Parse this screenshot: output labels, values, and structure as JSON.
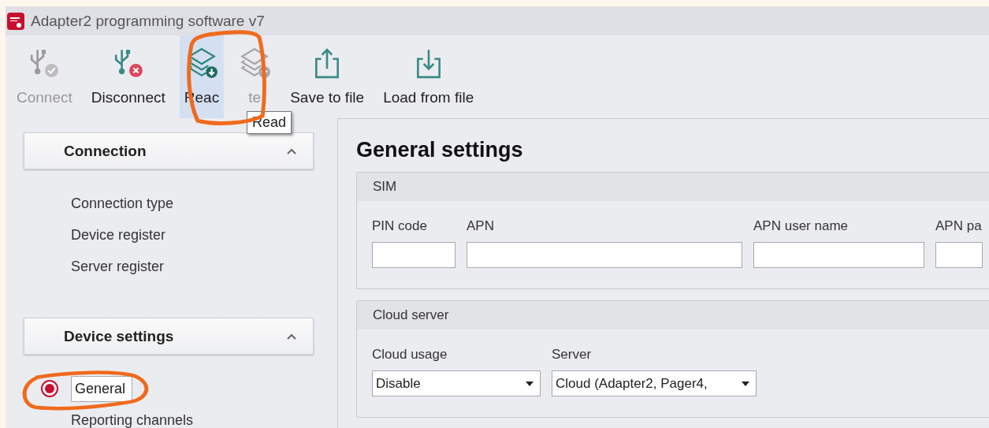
{
  "window": {
    "title": "Adapter2 programming software v7"
  },
  "toolbar": [
    {
      "label": "Connect",
      "kind": "usb-check",
      "disabled": true,
      "hovered": false
    },
    {
      "label": "Disconnect",
      "kind": "usb-x",
      "disabled": false,
      "hovered": false
    },
    {
      "label": "Reac",
      "kind": "layers-down",
      "disabled": false,
      "hovered": true
    },
    {
      "label": "te",
      "kind": "layers-up",
      "disabled": true,
      "hovered": false
    },
    {
      "label": "Save to file",
      "kind": "export",
      "disabled": false,
      "hovered": false
    },
    {
      "label": "Load from file",
      "kind": "import",
      "disabled": false,
      "hovered": false
    }
  ],
  "tooltip": "Read",
  "sidebar": [
    {
      "title": "Connection",
      "expanded": true,
      "items": [
        {
          "label": "Connection type",
          "selected": false
        },
        {
          "label": "Device register",
          "selected": false
        },
        {
          "label": "Server register",
          "selected": false
        }
      ]
    },
    {
      "title": "Device settings",
      "expanded": true,
      "items": [
        {
          "label": "General",
          "selected": true
        },
        {
          "label": "Reporting channels",
          "selected": false
        }
      ]
    }
  ],
  "page": {
    "title": "General settings",
    "groups": [
      {
        "title": "SIM",
        "fields": [
          {
            "label": "PIN code",
            "kind": "text"
          },
          {
            "label": "APN",
            "kind": "text"
          },
          {
            "label": "APN user name",
            "kind": "text"
          },
          {
            "label": "APN pa",
            "kind": "text"
          }
        ]
      },
      {
        "title": "Cloud server",
        "fields": [
          {
            "label": "Cloud usage",
            "kind": "select",
            "value": "Disable"
          },
          {
            "label": "Server",
            "kind": "select",
            "value": "Cloud (Adapter2, Pager4,"
          }
        ]
      }
    ]
  }
}
